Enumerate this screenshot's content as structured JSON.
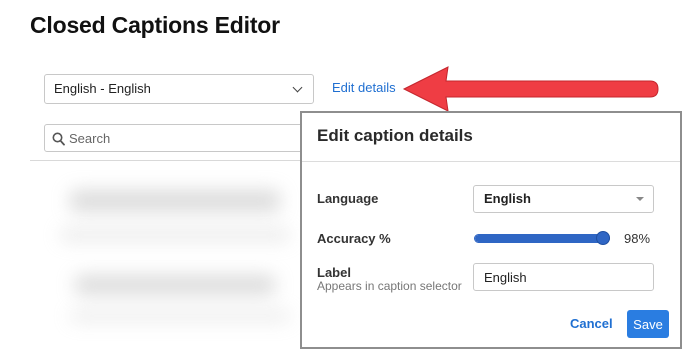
{
  "page": {
    "title": "Closed Captions Editor"
  },
  "toolbar": {
    "language_select_value": "English - English",
    "edit_details_label": "Edit details",
    "search_placeholder": "Search"
  },
  "dialog": {
    "title": "Edit caption details",
    "language_label": "Language",
    "language_value": "English",
    "accuracy_label": "Accuracy %",
    "accuracy_value": 98,
    "accuracy_display": "98%",
    "label_label": "Label",
    "label_sublabel": "Appears in caption selector",
    "label_value": "English",
    "cancel_label": "Cancel",
    "save_label": "Save"
  },
  "colors": {
    "accent": "#2a7de1",
    "link": "#1f6fd1",
    "annotation_arrow": "#ef3d44"
  },
  "icons": [
    "chevron-down-icon",
    "search-icon",
    "caret-down-icon",
    "annotation-arrow-icon"
  ]
}
